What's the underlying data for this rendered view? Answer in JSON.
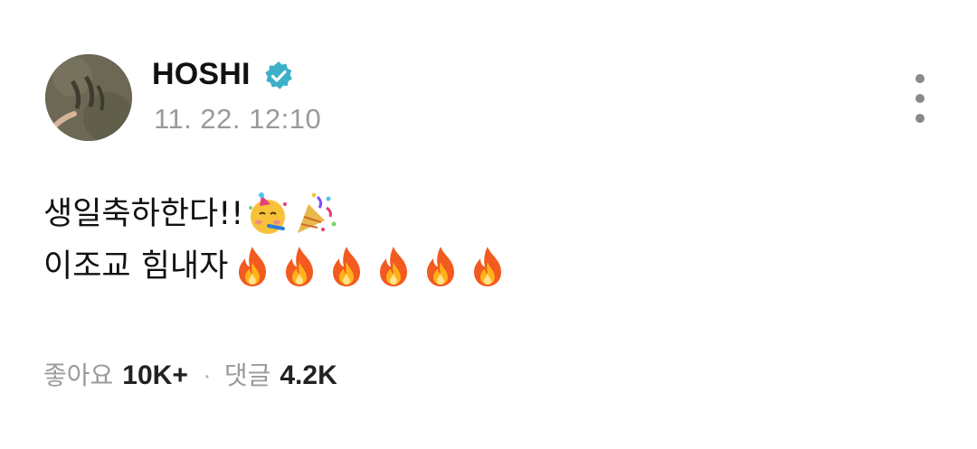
{
  "post": {
    "author": "HOSHI",
    "verified": true,
    "timestamp": "11. 22. 12:10",
    "body_line1": "생일축하한다!!",
    "body_line1_emojis": [
      "partying-face-emoji",
      "party-popper-emoji"
    ],
    "body_line2": "이조교 힘내자",
    "body_line2_emojis": [
      "fire-emoji",
      "fire-emoji",
      "fire-emoji",
      "fire-emoji",
      "fire-emoji",
      "fire-emoji"
    ]
  },
  "footer": {
    "likes_label": "좋아요",
    "likes_count": "10K+",
    "separator": "·",
    "comments_label": "댓글",
    "comments_count": "4.2K"
  },
  "icons": {
    "verified": "verified-badge-icon",
    "more": "more-vertical-icon"
  },
  "colors": {
    "verified_badge": "#3bb0c9",
    "timestamp": "#9a9a9a",
    "footer_label": "#9a9a9a",
    "text": "#111111"
  }
}
